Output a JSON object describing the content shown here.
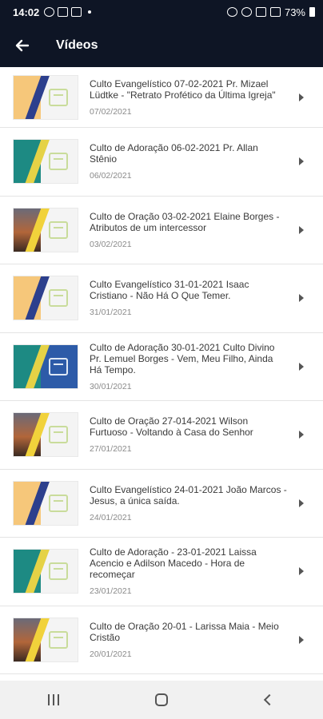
{
  "status_bar": {
    "time": "14:02",
    "battery": "73%",
    "icons": [
      "whatsapp-icon",
      "gallery-icon",
      "b-icon",
      "alarm-icon",
      "wifi-icon",
      "signal-icon",
      "signal-icon",
      "battery-icon"
    ]
  },
  "app_bar": {
    "title": "Vídeos",
    "back_icon": "arrow-left-icon"
  },
  "videos": [
    {
      "title": "Culto Evangelístico 07-02-2021 Pr. Mizael Lüdtke - \"Retrato Profético da Última Igreja\"",
      "date": "07/02/2021",
      "thumb": "domingo"
    },
    {
      "title": "Culto de Adoração 06-02-2021 Pr. Allan Stênio",
      "date": "06/02/2021",
      "thumb": "sabado"
    },
    {
      "title": "Culto de Oração 03-02-2021 Elaine Borges - Atributos de um intercessor",
      "date": "03/02/2021",
      "thumb": "quarta"
    },
    {
      "title": "Culto Evangelístico 31-01-2021 Isaac Cristiano - Não Há O Que Temer.",
      "date": "31/01/2021",
      "thumb": "domingo"
    },
    {
      "title": "Culto de Adoração 30-01-2021 Culto Divino Pr. Lemuel Borges - Vem, Meu Filho, Ainda Há Tempo.",
      "date": "30/01/2021",
      "thumb": "sabado-blue"
    },
    {
      "title": "Culto de Oração 27-014-2021 Wilson Furtuoso - Voltando à Casa do Senhor",
      "date": "27/01/2021",
      "thumb": "quarta"
    },
    {
      "title": "Culto Evangelístico 24-01-2021 João Marcos - Jesus, a única saída.",
      "date": "24/01/2021",
      "thumb": "domingo"
    },
    {
      "title": "Culto de Adoração - 23-01-2021 Laissa Acencio e Adilson Macedo - Hora de recomeçar",
      "date": "23/01/2021",
      "thumb": "sabado"
    },
    {
      "title": "Culto de Oração 20-01 - Larissa Maia - Meio Cristão",
      "date": "20/01/2021",
      "thumb": "quarta"
    }
  ],
  "nav_bar": {
    "recents_icon": "recents-icon",
    "home_icon": "home-icon",
    "back_icon": "back-icon"
  },
  "colors": {
    "app_bar": "#0e1525",
    "nav_bar": "#f1f1f1",
    "title_text": "#3a3a3a",
    "date_text": "#8a8a8a"
  }
}
